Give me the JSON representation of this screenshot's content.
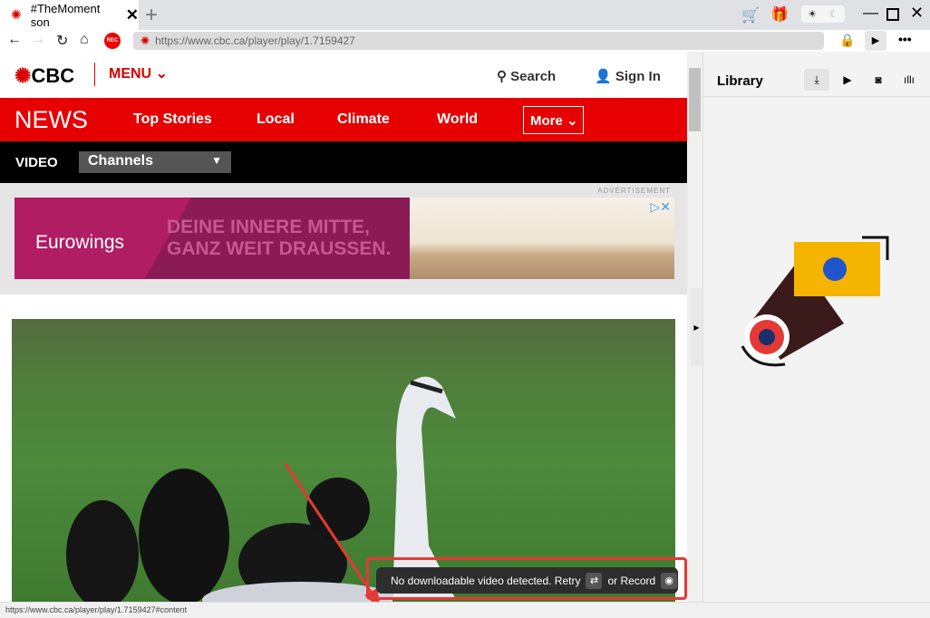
{
  "browser": {
    "tab_title": "#TheMoment son",
    "url": "https://www.cbc.ca/player/play/1.7159427",
    "rec_label": "REC",
    "status_url": "https://www.cbc.ca/player/play/1.7159427#content"
  },
  "cbc": {
    "logo": "CBC",
    "menu": "MENU",
    "search": "Search",
    "sign_in": "Sign In",
    "news": "NEWS",
    "nav": [
      "Top Stories",
      "Local",
      "Climate",
      "World"
    ],
    "more": "More",
    "video_label": "VIDEO",
    "channels": "Channels"
  },
  "ad": {
    "label": "ADVERTISEMENT",
    "brand": "Eurowings",
    "headline1": "DEINE INNERE MITTE,",
    "headline2": "GANZ WEIT DRAUSSEN."
  },
  "panel": {
    "title": "Library"
  },
  "toast": {
    "message": "No downloadable video detected. Retry",
    "or_record": "or Record"
  },
  "colors": {
    "cbc_red": "#e60000",
    "toast_border": "#e53935"
  }
}
